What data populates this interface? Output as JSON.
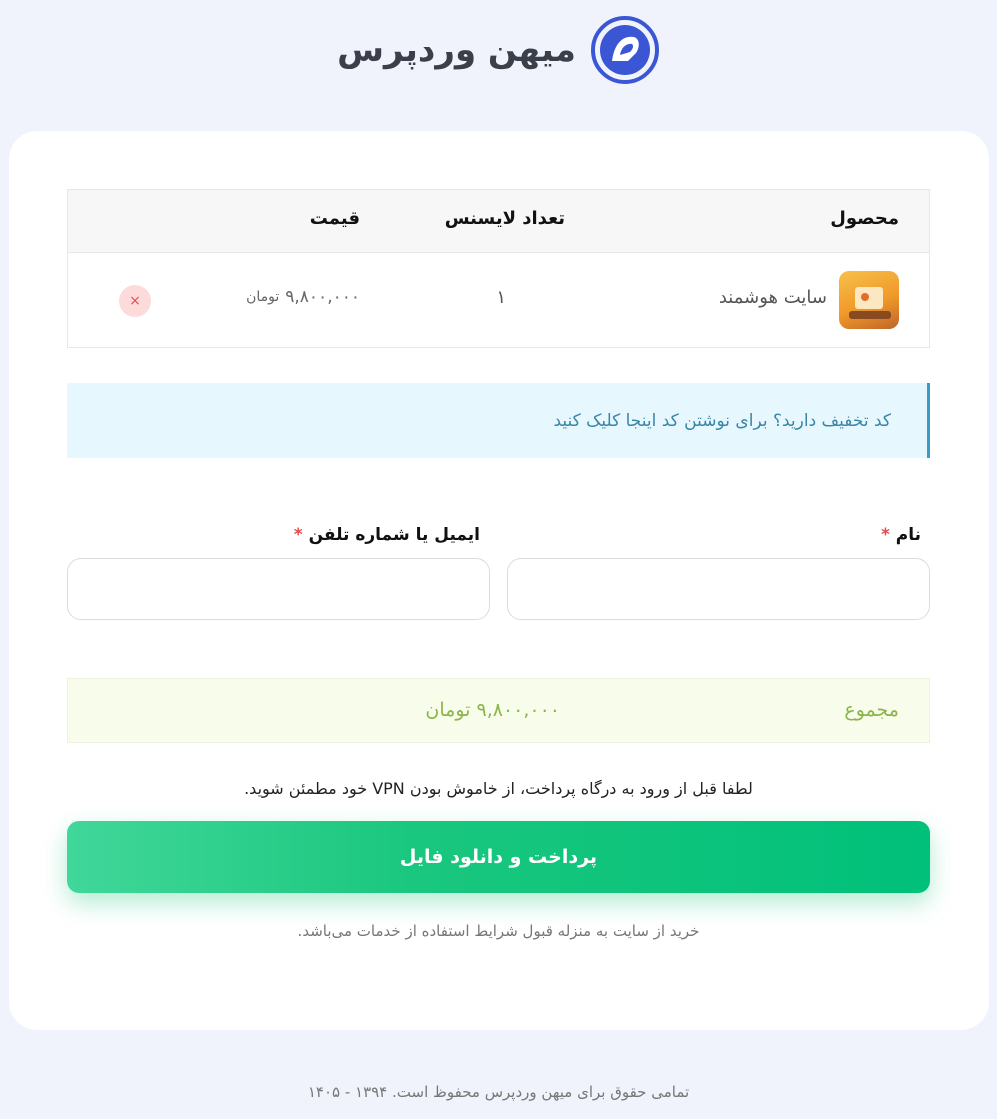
{
  "brand": {
    "logo_text": "میهن وردپرس"
  },
  "cart": {
    "headers": {
      "product": "محصول",
      "license_count": "تعداد لایسنس",
      "price": "قیمت"
    },
    "items": [
      {
        "name": "سایت هوشمند",
        "quantity": "۱",
        "price": "۹,۸۰۰,۰۰۰",
        "currency": "تومان",
        "remove_symbol": "×"
      }
    ]
  },
  "coupon": {
    "text": "کد تخفیف دارید؟ برای نوشتن کد اینجا کلیک کنید"
  },
  "form": {
    "name_label": "نام",
    "email_label": "ایمیل یا شماره تلفن",
    "required_mark": "*",
    "name_value": "",
    "email_value": ""
  },
  "total": {
    "label": "مجموع",
    "value": "۹,۸۰۰,۰۰۰ تومان"
  },
  "vpn_note": "لطفا قبل از ورود به درگاه پرداخت، از خاموش بودن VPN خود مطمئن شوید.",
  "pay_button": "پرداخت و دانلود فایل",
  "terms": "خرید از سایت به منزله قبول شرایط استفاده از خدمات می‌باشد.",
  "footer": "تمامی حقوق برای میهن وردپرس محفوظ است. ۱۳۹۴ - ۱۴۰۵",
  "colors": {
    "page_bg": "#f0f3fc",
    "accent_green": "#00c07a",
    "logo_blue": "#3b56d4",
    "total_text": "#8bb54a",
    "coupon_text": "#3a86a8"
  }
}
